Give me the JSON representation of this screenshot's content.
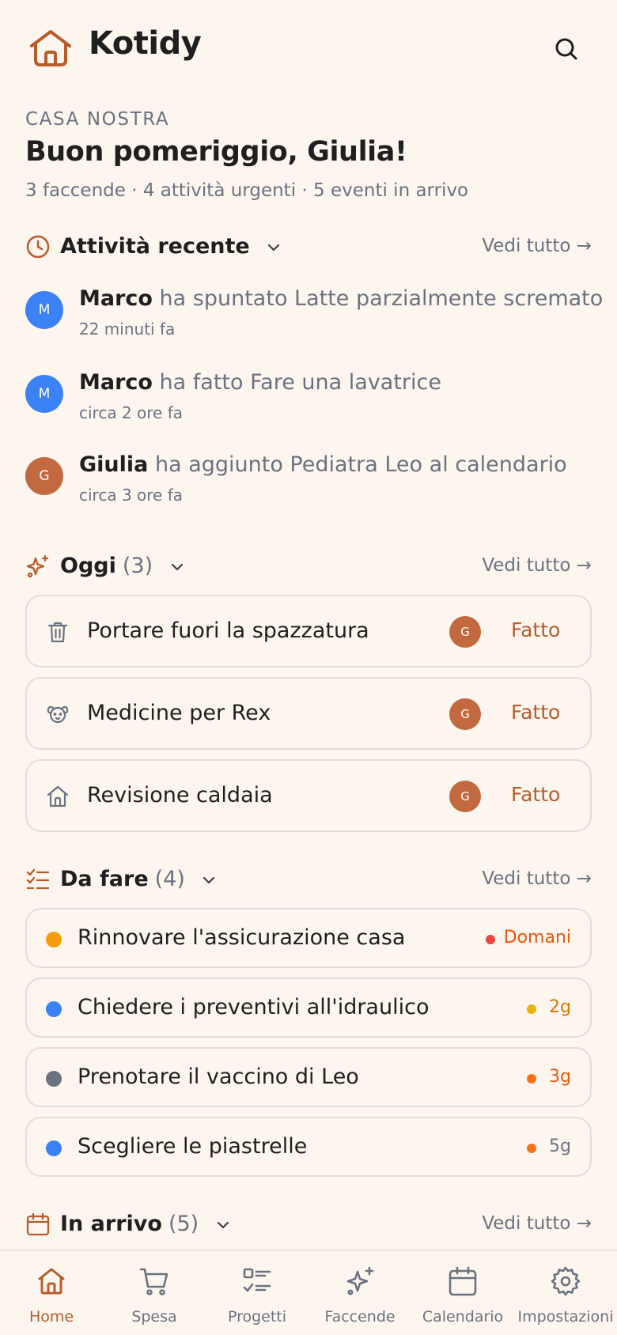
{
  "app": {
    "title": "Kotidy",
    "accent": "#b85c2b"
  },
  "header": {
    "eyebrow": "CASA NOSTRA",
    "greeting": "Buon pomeriggio, Giulia!",
    "summary": "3 faccende · 4 attività urgenti · 5 eventi in arrivo"
  },
  "recent": {
    "title": "Attività recente",
    "see_all": "Vedi tutto →",
    "items": [
      {
        "avatar": "M",
        "avatar_color": "#3b82f6",
        "name": "Marco",
        "action": " ha spuntato Latte parzialmente scremato",
        "time": "22 minuti fa"
      },
      {
        "avatar": "M",
        "avatar_color": "#3b82f6",
        "name": "Marco",
        "action": " ha fatto Fare una lavatrice",
        "time": "circa 2 ore fa"
      },
      {
        "avatar": "G",
        "avatar_color": "#c2693f",
        "name": "Giulia",
        "action": " ha aggiunto Pediatra Leo al calendario",
        "time": "circa 3 ore fa"
      }
    ]
  },
  "today": {
    "title": "Oggi",
    "count": "(3)",
    "see_all": "Vedi tutto →",
    "items": [
      {
        "icon": "trash-icon",
        "label": "Portare fuori la spazzatura",
        "avatar": "G",
        "done_label": "Fatto"
      },
      {
        "icon": "pet-icon",
        "label": "Medicine per Rex",
        "avatar": "G",
        "done_label": "Fatto"
      },
      {
        "icon": "house-icon",
        "label": "Revisione caldaia",
        "avatar": "G",
        "done_label": "Fatto"
      }
    ]
  },
  "todo": {
    "title": "Da fare",
    "count": "(4)",
    "see_all": "Vedi tutto →",
    "items": [
      {
        "label": "Rinnovare l'assicurazione casa",
        "dot_color": "#f59e0b",
        "due": "Domani",
        "due_dot": "#ef4444",
        "due_color": "#ea580c"
      },
      {
        "label": "Chiedere i preventivi all'idraulico",
        "dot_color": "#3b82f6",
        "due": "2g",
        "due_dot": "#eab308",
        "due_color": "#d97706"
      },
      {
        "label": "Prenotare il vaccino di Leo",
        "dot_color": "#6b7280",
        "due": "3g",
        "due_dot": "#f97316",
        "due_color": "#ea580c"
      },
      {
        "label": "Scegliere le piastrelle",
        "dot_color": "#3b82f6",
        "due": "5g",
        "due_dot": "#f97316",
        "due_color": "#6b7280"
      }
    ]
  },
  "upcoming": {
    "title": "In arrivo",
    "count": "(5)",
    "see_all": "Vedi tutto →"
  },
  "nav": {
    "items": [
      {
        "label": "Home",
        "icon": "home-icon",
        "active": true
      },
      {
        "label": "Spesa",
        "icon": "cart-icon"
      },
      {
        "label": "Progetti",
        "icon": "checklist-icon"
      },
      {
        "label": "Faccende",
        "icon": "sparkles-icon"
      },
      {
        "label": "Calendario",
        "icon": "calendar-icon"
      },
      {
        "label": "Impostazioni",
        "icon": "gear-icon"
      }
    ]
  }
}
